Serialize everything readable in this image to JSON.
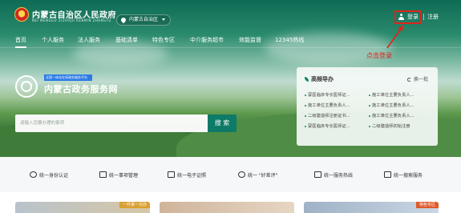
{
  "header": {
    "site_title": "内蒙古自治区人民政府",
    "site_subtitle": "NEI MENGGU ZIZHIQU RENMIN ZHENGFU",
    "location": "内蒙古自治区",
    "login": "登录",
    "register": "注册"
  },
  "nav": {
    "items": [
      {
        "label": "首页",
        "active": true
      },
      {
        "label": "个人服务"
      },
      {
        "label": "法人服务"
      },
      {
        "label": "基础清单"
      },
      {
        "label": "特色专区"
      },
      {
        "label": "中介服务超市"
      },
      {
        "label": "效能监督"
      },
      {
        "label": "12345热线"
      }
    ]
  },
  "annotation": {
    "hint": "点击登录",
    "color": "#e2231a"
  },
  "brand": {
    "tagline": "全国一体化在线政务服务平台",
    "name": "内蒙古政务服务网"
  },
  "search": {
    "placeholder": "请输入您要办理的事项",
    "button": "搜 索"
  },
  "guide_panel": {
    "title": "高频导办",
    "refresh": "换一批",
    "items": [
      "蒙医临床专长医师证...",
      "施工单位主要负责人...",
      "施工单位主要负责人...",
      "施工单位主要负责人...",
      "二级建造师注册证书...",
      "施工单位主要负责人...",
      "蒙医临床专长医师证...",
      "二级建造师初始注册"
    ]
  },
  "services": [
    {
      "label": "统一身份认证",
      "icon": "id-auth-icon"
    },
    {
      "label": "统一事项管理",
      "icon": "list-manage-icon"
    },
    {
      "label": "统一电子证照",
      "icon": "e-license-icon"
    },
    {
      "label": "统一 \"好差评\"",
      "icon": "rating-icon"
    },
    {
      "label": "统一服务热线",
      "icon": "hotline-icon"
    },
    {
      "label": "统一搜索服务",
      "icon": "search-service-icon"
    }
  ],
  "cards": [
    {
      "tag": "一件事一次办",
      "tag_color": "#d9a033"
    },
    {
      "tag": ""
    },
    {
      "tag": "特色专区",
      "tag_color": "#e05a2a"
    }
  ],
  "colors": {
    "primary": "#0e7a68",
    "accent_red": "#e2231a"
  }
}
